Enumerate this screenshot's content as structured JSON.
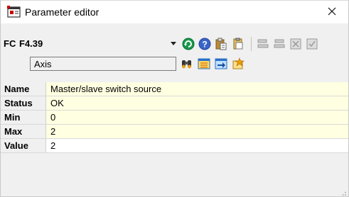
{
  "window": {
    "title": "Parameter editor"
  },
  "toolbar": {
    "fc_label": "FC",
    "fc_value": "F4.39",
    "icons": [
      "refresh-icon",
      "help-icon",
      "clipboard-icon",
      "align-left-icon",
      "align-center-icon",
      "close-box-icon",
      "checkbox-icon"
    ]
  },
  "search": {
    "axis_value": "Axis",
    "icons": [
      "binoculars-icon",
      "list-grid-icon",
      "import-icon",
      "sparkle-icon"
    ]
  },
  "params": [
    {
      "label": "Name",
      "value": "Master/slave switch source"
    },
    {
      "label": "Status",
      "value": "OK"
    },
    {
      "label": "Min",
      "value": "0"
    },
    {
      "label": "Max",
      "value": "2"
    },
    {
      "label": "Value",
      "value": "2"
    }
  ],
  "colors": {
    "value_bg": "#ffffe1",
    "label_bg": "#f0f0f0",
    "accent": "#0a7d3c"
  }
}
